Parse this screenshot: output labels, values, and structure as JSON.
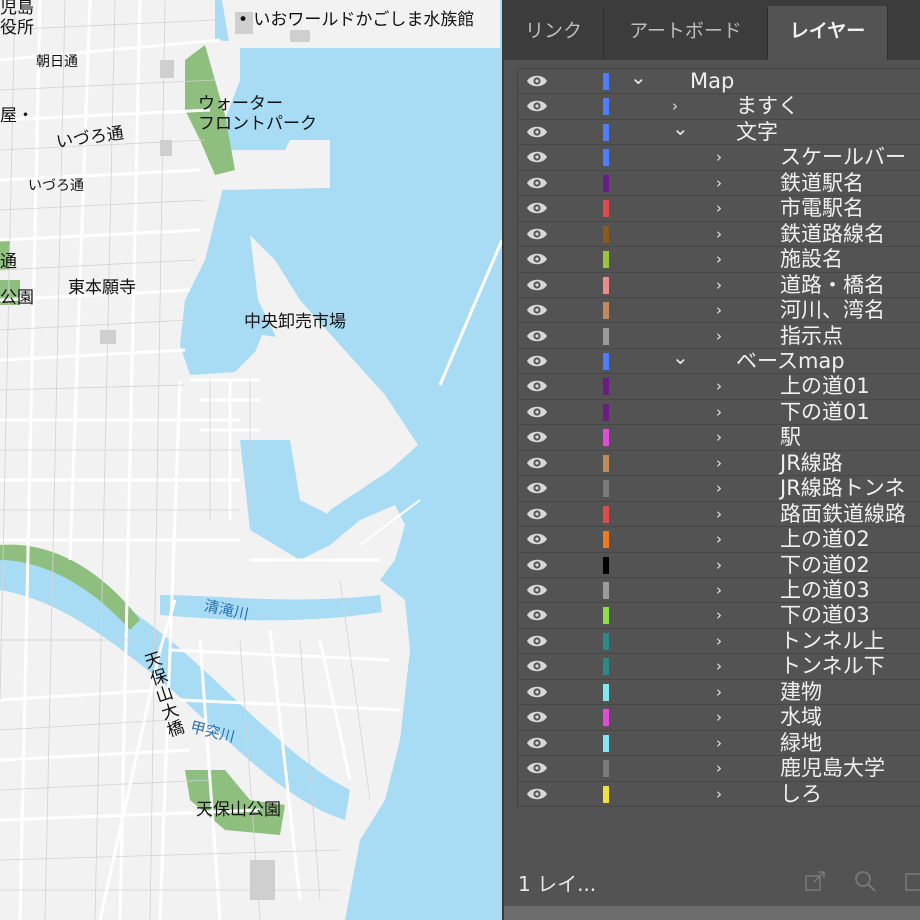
{
  "map": {
    "labels": {
      "aquarium": "• いおワールドかごしま水族館",
      "asahi": "朝日通",
      "waterfront1": "ウォーター",
      "waterfront2": "フロントパーク",
      "izuro1": "いづろ通",
      "izuro2": "いづろ通",
      "higashi": "東本願寺",
      "market": "中央卸売市場",
      "kiyotaki": "清滝川",
      "tenpozan_bridge": "天保山大橋",
      "kotsuki": "甲突川",
      "tenpozan_park": "天保山公園",
      "kagoshima": "児島",
      "yakusho": "役所",
      "ya": "屋・",
      "tsu": "通",
      "park_left": "公園"
    }
  },
  "panel": {
    "tabs": [
      "リンク",
      "アートボード",
      "レイヤー"
    ],
    "active_tab": "レイヤー",
    "footer_count": "1 レイ...",
    "layers": [
      {
        "name": "Map",
        "color": "#4f7dff",
        "expanded": true,
        "depth": 0
      },
      {
        "name": "ますく",
        "color": "#4f7dff",
        "expanded": false,
        "depth": 1
      },
      {
        "name": "文字",
        "color": "#4f7dff",
        "expanded": true,
        "depth": 1
      },
      {
        "name": "スケールバー",
        "color": "#4f7dff",
        "expanded": false,
        "depth": 2
      },
      {
        "name": "鉄道駅名",
        "color": "#6b1b86",
        "expanded": false,
        "depth": 2
      },
      {
        "name": "市電駅名",
        "color": "#e04a4a",
        "expanded": false,
        "depth": 2
      },
      {
        "name": "鉄道路線名",
        "color": "#8a5a1c",
        "expanded": false,
        "depth": 2
      },
      {
        "name": "施設名",
        "color": "#9ac43a",
        "expanded": false,
        "depth": 2
      },
      {
        "name": "道路・橋名",
        "color": "#f08a8a",
        "expanded": false,
        "depth": 2
      },
      {
        "name": "河川、湾名",
        "color": "#c08a5a",
        "expanded": false,
        "depth": 2
      },
      {
        "name": "指示点",
        "color": "#9a9a9a",
        "expanded": false,
        "depth": 2
      },
      {
        "name": "ベースmap",
        "color": "#4f7dff",
        "expanded": true,
        "depth": 1
      },
      {
        "name": "上の道01",
        "color": "#6b1b86",
        "expanded": false,
        "depth": 2
      },
      {
        "name": "下の道01",
        "color": "#6b1b86",
        "expanded": false,
        "depth": 2
      },
      {
        "name": "駅",
        "color": "#e24bd8",
        "expanded": false,
        "depth": 2
      },
      {
        "name": "JR線路",
        "color": "#c08a5a",
        "expanded": false,
        "depth": 2
      },
      {
        "name": "JR線路トンネ",
        "color": "#7a7a7a",
        "expanded": false,
        "depth": 2
      },
      {
        "name": "路面鉄道線路",
        "color": "#e04a4a",
        "expanded": false,
        "depth": 2
      },
      {
        "name": "上の道02",
        "color": "#f07a1a",
        "expanded": false,
        "depth": 2
      },
      {
        "name": "下の道02",
        "color": "#000000",
        "expanded": false,
        "depth": 2
      },
      {
        "name": "上の道03",
        "color": "#9a9a9a",
        "expanded": false,
        "depth": 2
      },
      {
        "name": "下の道03",
        "color": "#8be04a",
        "expanded": false,
        "depth": 2
      },
      {
        "name": "トンネル上",
        "color": "#2a8a8a",
        "expanded": false,
        "depth": 2
      },
      {
        "name": "トンネル下",
        "color": "#2a8a8a",
        "expanded": false,
        "depth": 2
      },
      {
        "name": "建物",
        "color": "#7fe8f2",
        "expanded": false,
        "depth": 2
      },
      {
        "name": "水域",
        "color": "#e24bd8",
        "expanded": false,
        "depth": 2
      },
      {
        "name": "緑地",
        "color": "#7fe8f2",
        "expanded": false,
        "depth": 2
      },
      {
        "name": "鹿児島大学",
        "color": "#7a7a7a",
        "expanded": false,
        "depth": 2
      },
      {
        "name": "しろ",
        "color": "#f2e03a",
        "expanded": false,
        "depth": 2
      }
    ]
  }
}
